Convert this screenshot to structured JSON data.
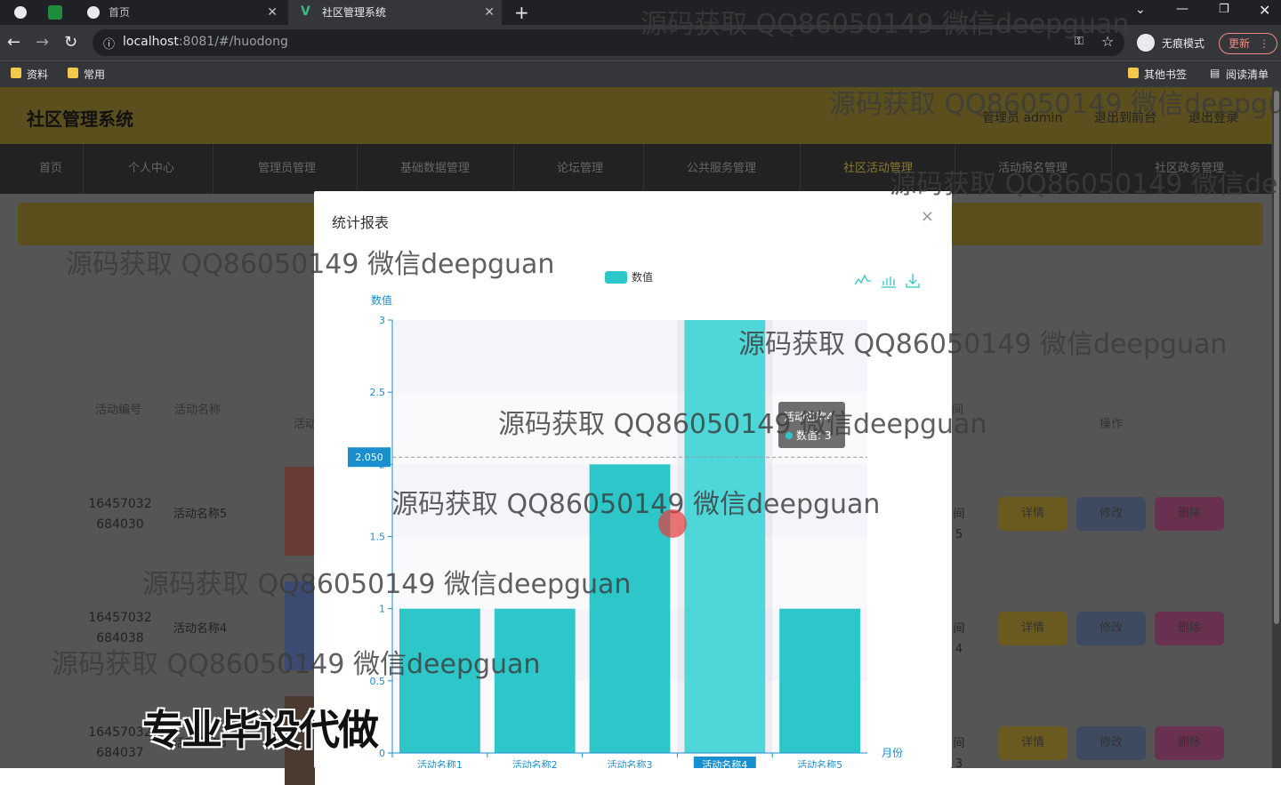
{
  "browser": {
    "tabs": [
      {
        "label": "首页"
      },
      {
        "label": "社区管理系统"
      }
    ],
    "url_host": "localhost",
    "url_rest": ":8081/#/huodong",
    "incognito_label": "无痕模式",
    "update_label": "更新",
    "bookmarks": [
      "资料",
      "常用"
    ],
    "other_bookmarks": "其他书签",
    "reading_list": "阅读清单"
  },
  "app": {
    "title": "社区管理系统",
    "user": "管理员 admin",
    "to_front": "退出到前台",
    "logout": "退出登录",
    "nav": [
      "首页",
      "个人中心",
      "管理员管理",
      "基础数据管理",
      "论坛管理",
      "公共服务管理",
      "社区活动管理",
      "活动报名管理",
      "社区政务管理"
    ]
  },
  "table": {
    "headers": [
      "活动编号",
      "活动名称",
      "活动",
      "间",
      "操作"
    ],
    "rows": [
      {
        "id_a": "16457032",
        "id_b": "684030",
        "name": "活动名称5",
        "time": "间5"
      },
      {
        "id_a": "16457032",
        "id_b": "684038",
        "name": "活动名称4",
        "time": "间4"
      },
      {
        "id_a": "16457032",
        "id_b": "684037",
        "name": "活动名称3",
        "time": "间3"
      }
    ],
    "btn_detail": "详情",
    "btn_edit": "修改",
    "btn_delete": "删除"
  },
  "modal": {
    "title": "统计报表",
    "close": "×"
  },
  "chart_data": {
    "type": "bar",
    "legend": "数值",
    "ylabel": "数值",
    "xlabel": "月份",
    "categories": [
      "活动名称1",
      "活动名称2",
      "活动名称3",
      "活动名称4",
      "活动名称5"
    ],
    "series": [
      {
        "name": "数值",
        "values": [
          1,
          1,
          2,
          3,
          1
        ]
      }
    ],
    "yticks": [
      "0",
      "0.5",
      "1",
      "1.5",
      "2",
      "2.5",
      "3"
    ],
    "ylim": [
      0,
      3
    ],
    "pointer_value": "2.050",
    "tooltip_title": "活动名称4",
    "tooltip_value": "数值: 3",
    "highlight_category": "活动名称4",
    "bar_color": "#2ec7c9",
    "accent": "#1a8fcf"
  },
  "watermarks": {
    "text": "源码获取 QQ86050149 微信deepguan",
    "big": "专业毕设代做"
  }
}
